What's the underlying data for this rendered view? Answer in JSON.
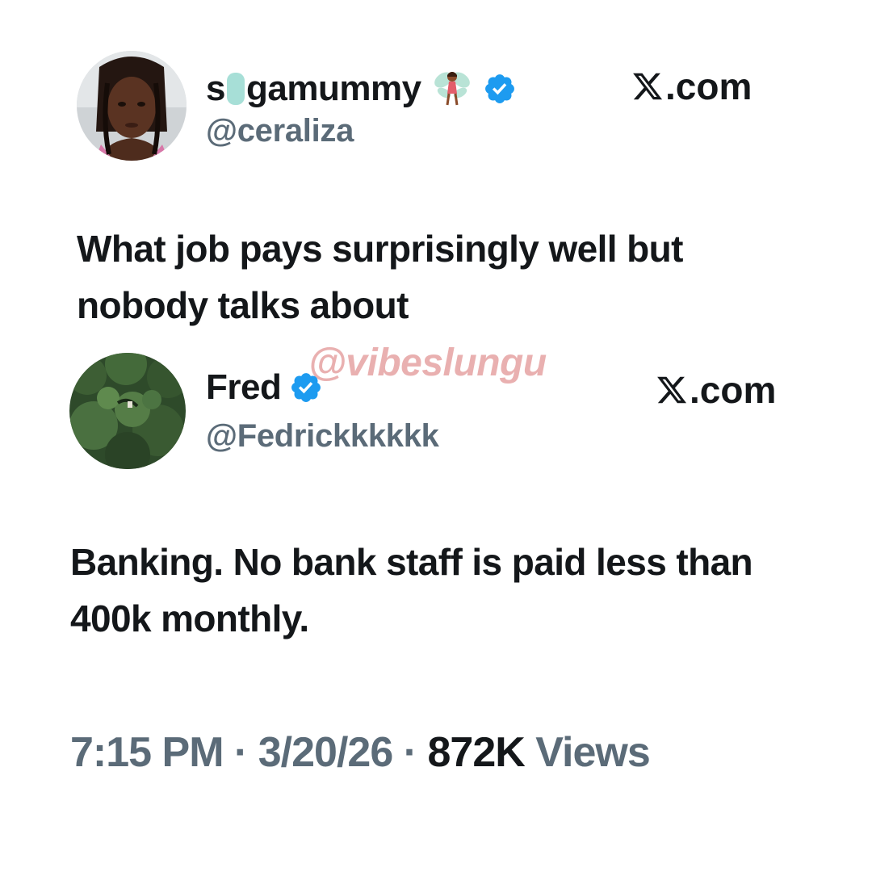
{
  "colors": {
    "verified": "#1d9bf0",
    "text": "#14171a",
    "secondary": "#5b6b78",
    "watermark": "#e29696"
  },
  "original_tweet": {
    "display_name": "s gamummy",
    "display_name_part1": "s",
    "display_name_part2": "gamummy",
    "handle": "@ceraliza",
    "text": "What job pays surprisingly well but nobody talks about",
    "source": ".com",
    "icons": [
      "avatar",
      "fairy-emoji-icon",
      "verified-badge-icon",
      "x-logo-icon"
    ]
  },
  "watermark": "@vibeslungu",
  "reply_tweet": {
    "display_name": "Fred",
    "handle": "@Fedrickkkkkk",
    "text": "Banking. No bank staff is paid less than 400k monthly.",
    "source": ".com",
    "icons": [
      "avatar",
      "verified-badge-icon",
      "x-logo-icon"
    ]
  },
  "meta": {
    "time": "7:15 PM",
    "separator": "·",
    "date": "3/20/26",
    "views_count": "872K",
    "views_label": "Views"
  }
}
